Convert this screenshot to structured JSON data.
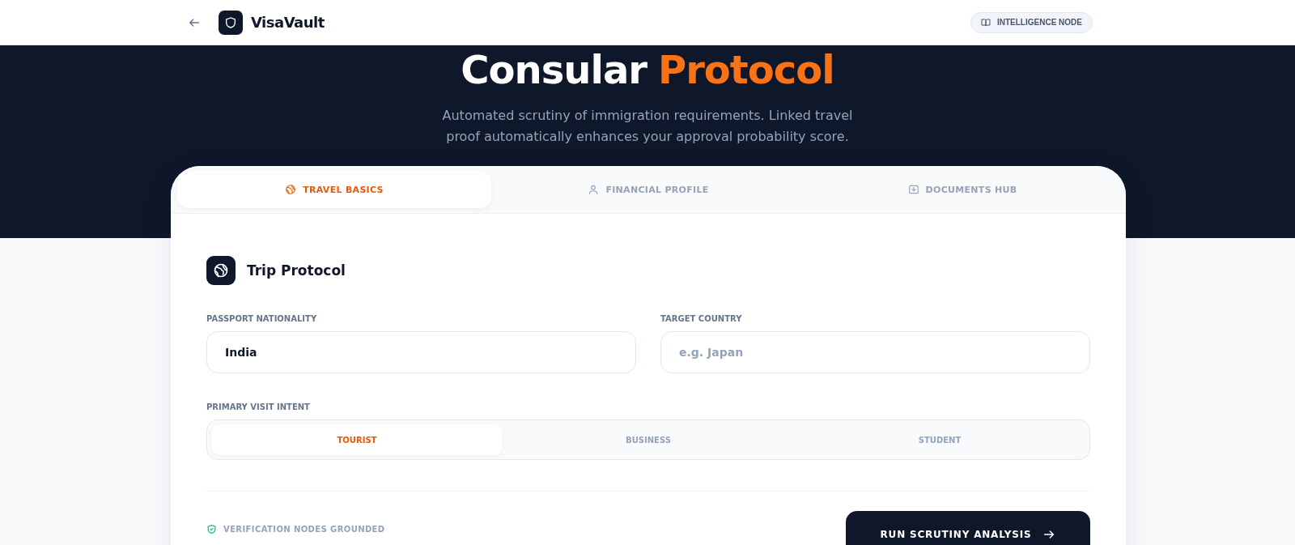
{
  "header": {
    "brand": "VisaVault",
    "badge": "INTELLIGENCE NODE"
  },
  "hero": {
    "title": "Consular",
    "title_accent": "Protocol",
    "subtitle": "Automated scrutiny of immigration requirements. Linked travel proof automatically enhances your approval probability score."
  },
  "tabs": [
    {
      "label": "TRAVEL BASICS",
      "kind": "globe",
      "selected": true
    },
    {
      "label": "FINANCIAL PROFILE",
      "kind": "user",
      "selected": false
    },
    {
      "label": "DOCUMENTS HUB",
      "kind": "download",
      "selected": false
    }
  ],
  "section": {
    "title": "Trip Protocol"
  },
  "fields": [
    {
      "label": "PASSPORT NATIONALITY",
      "value": "India"
    },
    {
      "label": "TARGET COUNTRY",
      "placeholder": "e.g. Japan"
    }
  ],
  "intent": {
    "label": "PRIMARY VISIT INTENT",
    "options": [
      {
        "label": "TOURIST",
        "selected": true
      },
      {
        "label": "BUSINESS",
        "selected": false
      },
      {
        "label": "STUDENT",
        "selected": false
      }
    ]
  },
  "footer": {
    "status": "VERIFICATION NODES GROUNDED",
    "button": "RUN SCRUTINY ANALYSIS"
  }
}
